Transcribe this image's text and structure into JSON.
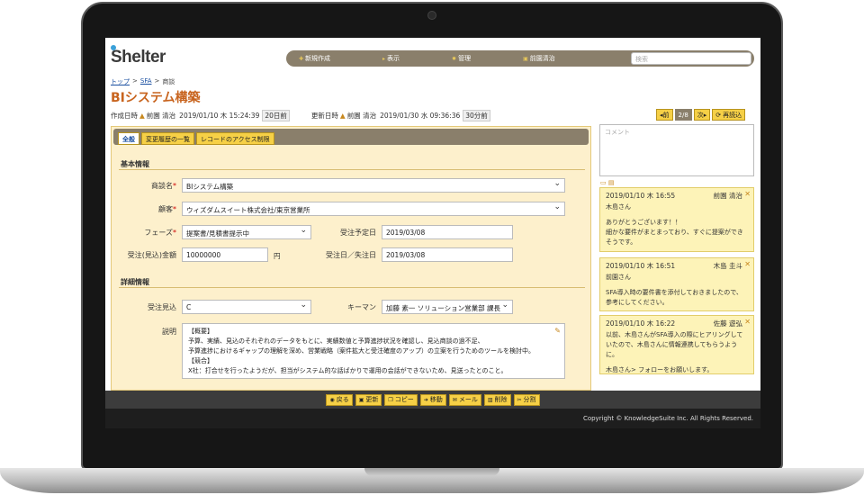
{
  "header": {
    "logo": "Shelter",
    "menu": [
      {
        "icon": "plus-icon",
        "label": "新規作成"
      },
      {
        "icon": "arrow-icon",
        "label": "表示"
      },
      {
        "icon": "gear-icon",
        "label": "管理"
      },
      {
        "icon": "person-icon",
        "label": "前園清治"
      }
    ],
    "search_placeholder": "検索"
  },
  "breadcrumb": [
    "トップ",
    "SFA",
    "商談"
  ],
  "page_title": "BIシステム構築",
  "meta": {
    "created_label": "作成日時",
    "created_user": "前園 清治",
    "created_date": "2019/01/10 木 15:24:39",
    "created_ago": "20日前",
    "updated_label": "更新日時",
    "updated_user": "前園 清治",
    "updated_date": "2019/01/30 水 09:36:36",
    "updated_ago": "30分前"
  },
  "pager": {
    "prev": "前",
    "page": "2/8",
    "next": "次",
    "reload": "再読込"
  },
  "tabs": [
    "全般",
    "変更履歴の一覧",
    "レコードのアクセス制限"
  ],
  "form": {
    "section_basic": "基本情報",
    "deal_name_label": "商談名",
    "deal_name": "BIシステム構築",
    "customer_label": "顧客",
    "customer": "ウィズダムスイート株式会社/東京営業所",
    "phase_label": "フェーズ",
    "phase": "提案書/見積書提示中",
    "order_planned_label": "受注予定日",
    "order_planned": "2019/03/08",
    "amount_label": "受注(見込)金額",
    "amount": "10000000",
    "amount_unit": "円",
    "order_date_label": "受注日／失注日",
    "order_date": "2019/03/08",
    "section_detail": "詳細情報",
    "prospect_label": "受注見込",
    "prospect": "C",
    "keyman_label": "キーマン",
    "keyman": "加藤 素一 ソリューション営業部 課長",
    "desc_label": "説明",
    "description": [
      "【概要】",
      "予算、実績、見込のそれぞれのデータをもとに、実績数値と予算進捗状況を確認し、見込商談の過不足、",
      "予算進捗におけるギャップの理解を深め、営業戦略（案件拡大と受注確度のアップ）の立案を行うためのツールを検討中。",
      "【競合】",
      "X社：打合せを行ったようだが、担当がシステム的な話ばかりで運用の会話ができないため、見送ったとのこと。"
    ]
  },
  "comments": {
    "placeholder": "コメント",
    "items": [
      {
        "date": "2019/01/10 木 16:55",
        "author": "前園 清治",
        "lines": [
          "木島さん",
          "",
          "ありがとうございます！！",
          "細かな要件がまとまっており、すぐに提案ができそうです。"
        ]
      },
      {
        "date": "2019/01/10 木 16:51",
        "author": "木島 圭斗",
        "lines": [
          "前園さん",
          "",
          "SFA導入時の要件書を添付しておきましたので、参考にしてください。"
        ]
      },
      {
        "date": "2019/01/10 木 16:22",
        "author": "佐藤 遊弘",
        "lines": [
          "以前、木島さんがSFA導入の際にヒアリングしていたので、木島さんに情報連携してもらうように。",
          "",
          "木島さん> フォローをお願いします。"
        ]
      }
    ]
  },
  "actions": [
    {
      "icon": "back-icon",
      "label": "戻る"
    },
    {
      "icon": "save-icon",
      "label": "更新"
    },
    {
      "icon": "copy-icon",
      "label": "コピー"
    },
    {
      "icon": "move-icon",
      "label": "移動"
    },
    {
      "icon": "mail-icon",
      "label": "メール"
    },
    {
      "icon": "trash-icon",
      "label": "削除"
    },
    {
      "icon": "split-icon",
      "label": "分割"
    }
  ],
  "footer": "Copyright © KnowledgeSuite Inc. All Rights Reserved."
}
